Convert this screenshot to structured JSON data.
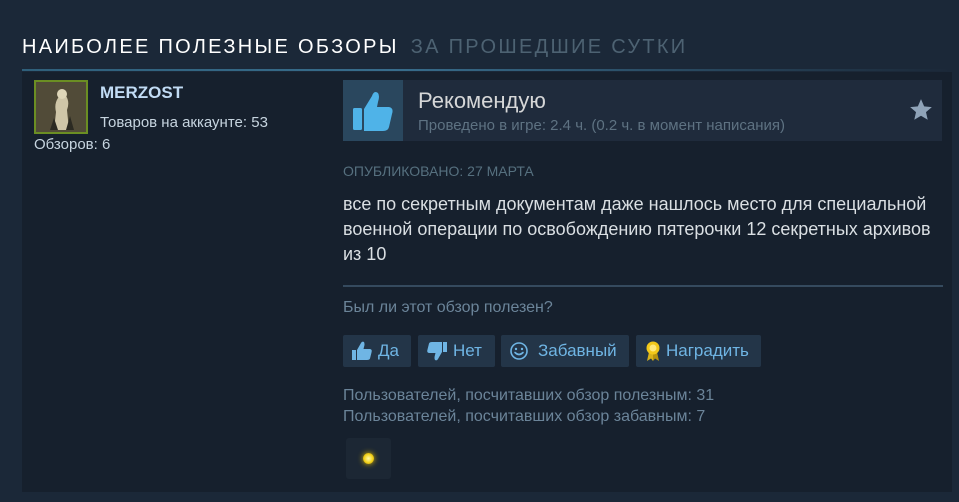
{
  "section": {
    "title": "НАИБОЛЕЕ ПОЛЕЗНЫЕ ОБЗОРЫ",
    "subtitle": "ЗА ПРОШЕДШИЕ СУТКИ"
  },
  "author": {
    "name": "MERZOST",
    "products": "Товаров на аккаунте: 53",
    "reviews": "Обзоров: 6"
  },
  "review": {
    "verdict": "Рекомендую",
    "playtime": "Проведено в игре: 2.4 ч. (0.2 ч. в момент написания)",
    "posted": "Опубликовано: 27 марта",
    "text": "все по секретным документам даже нашлось место для специальной военной операции по освобождению пятерочки 12 секретных архивов из 10",
    "helpful_question": "Был ли этот обзор полезен?",
    "buttons": {
      "yes": "Да",
      "no": "Нет",
      "funny": "Забавный",
      "award": "Наградить"
    },
    "helpful_count": "Пользователей, посчитавших обзор полезным: 31",
    "funny_count": "Пользователей, посчитавших обзор забавным: 7"
  },
  "colors": {
    "background": "#1b2838",
    "panel": "#16202d",
    "link": "#6fb5e4",
    "thumb": "#4fb3e8"
  },
  "icons": [
    "thumbs-up-icon",
    "star-icon",
    "thumbs-down-icon",
    "smiley-icon",
    "award-ribbon-icon",
    "award-badge-icon"
  ]
}
